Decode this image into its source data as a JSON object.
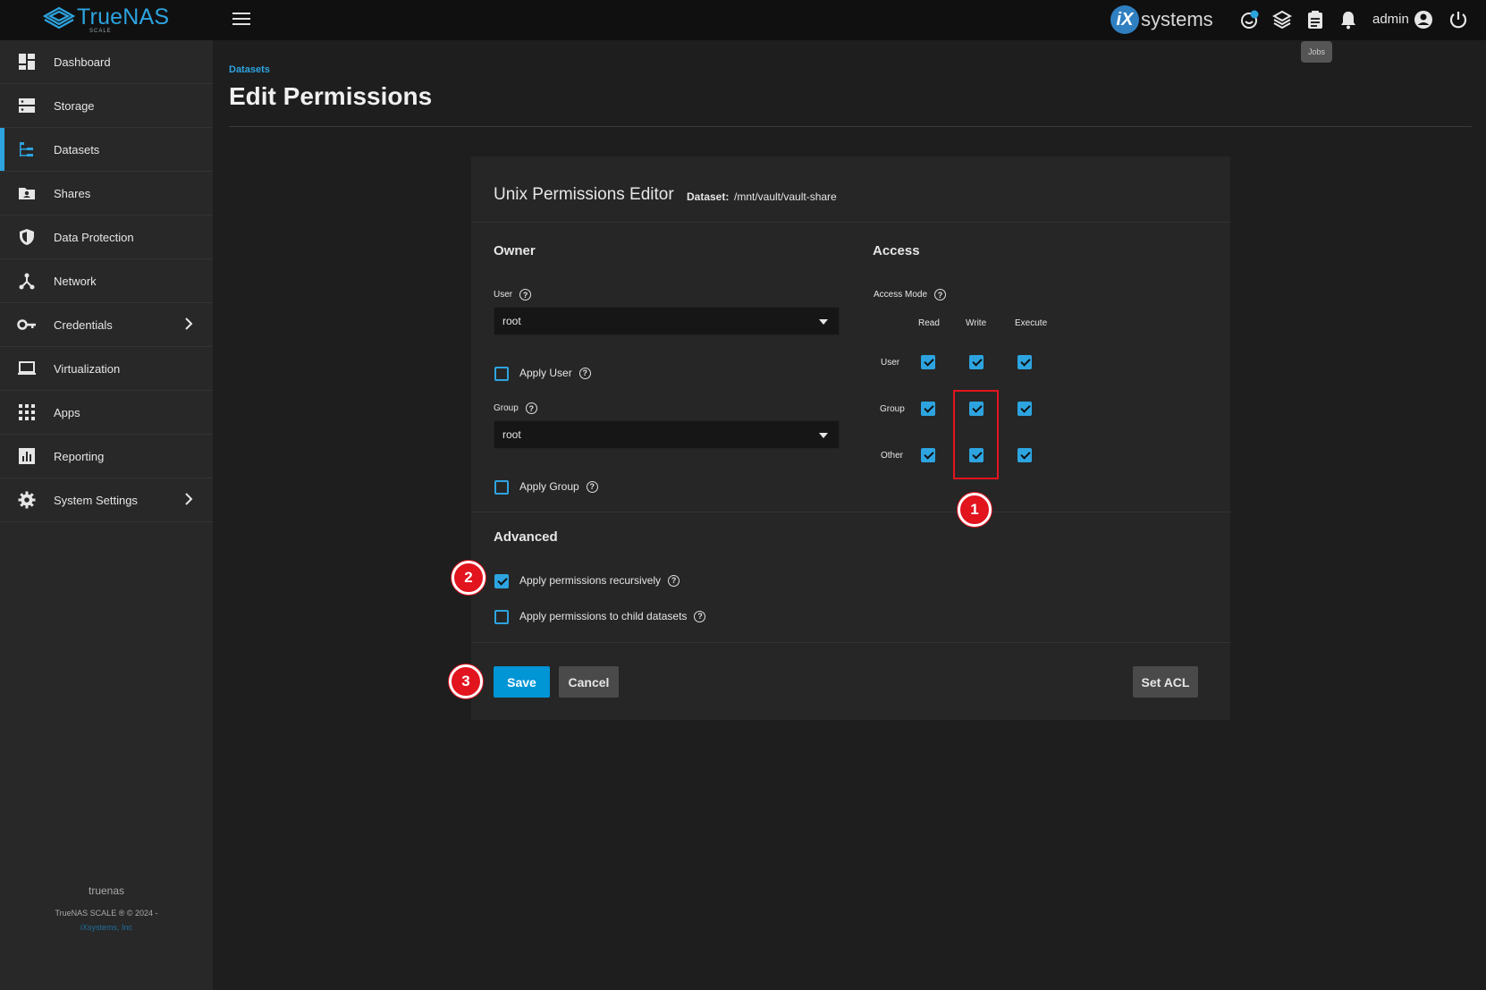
{
  "topbar": {
    "logo_text": "TrueNAS",
    "logo_sub": "SCALE",
    "vendor_badge": "iX",
    "vendor_text": "systems",
    "user": "admin",
    "tooltip": "Jobs"
  },
  "sidebar": {
    "items": [
      {
        "label": "Dashboard",
        "icon": "dashboard-icon"
      },
      {
        "label": "Storage",
        "icon": "storage-icon"
      },
      {
        "label": "Datasets",
        "icon": "datasets-icon",
        "active": true
      },
      {
        "label": "Shares",
        "icon": "shares-icon"
      },
      {
        "label": "Data Protection",
        "icon": "shield-icon"
      },
      {
        "label": "Network",
        "icon": "network-icon"
      },
      {
        "label": "Credentials",
        "icon": "key-icon",
        "has_children": true
      },
      {
        "label": "Virtualization",
        "icon": "laptop-icon"
      },
      {
        "label": "Apps",
        "icon": "apps-grid-icon"
      },
      {
        "label": "Reporting",
        "icon": "reporting-icon"
      },
      {
        "label": "System Settings",
        "icon": "gear-icon",
        "has_children": true
      }
    ],
    "footer_host": "truenas",
    "footer_copy": "TrueNAS SCALE ® © 2024 -",
    "footer_link": "iXsystems, Inc"
  },
  "page": {
    "breadcrumb": "Datasets",
    "title": "Edit Permissions"
  },
  "editor": {
    "title": "Unix Permissions Editor",
    "dataset_label": "Dataset:",
    "dataset_path": "/mnt/vault/vault-share",
    "owner": {
      "section": "Owner",
      "user_label": "User",
      "user_value": "root",
      "apply_user_label": "Apply User",
      "apply_user": false,
      "group_label": "Group",
      "group_value": "root",
      "apply_group_label": "Apply Group",
      "apply_group": false
    },
    "access": {
      "section": "Access",
      "mode_label": "Access Mode",
      "columns": [
        "Read",
        "Write",
        "Execute"
      ],
      "rows": [
        "User",
        "Group",
        "Other"
      ],
      "values": [
        [
          true,
          true,
          true
        ],
        [
          true,
          true,
          true
        ],
        [
          true,
          true,
          true
        ]
      ]
    },
    "advanced": {
      "section": "Advanced",
      "recursive_label": "Apply permissions recursively",
      "recursive": true,
      "child_label": "Apply permissions to child datasets",
      "child": false
    },
    "buttons": {
      "save": "Save",
      "cancel": "Cancel",
      "set_acl": "Set ACL"
    }
  },
  "annotations": [
    "1",
    "2",
    "3"
  ],
  "colors": {
    "accent": "#2da4e0",
    "primary_button": "#0095d5",
    "annotation": "#e2141e"
  }
}
